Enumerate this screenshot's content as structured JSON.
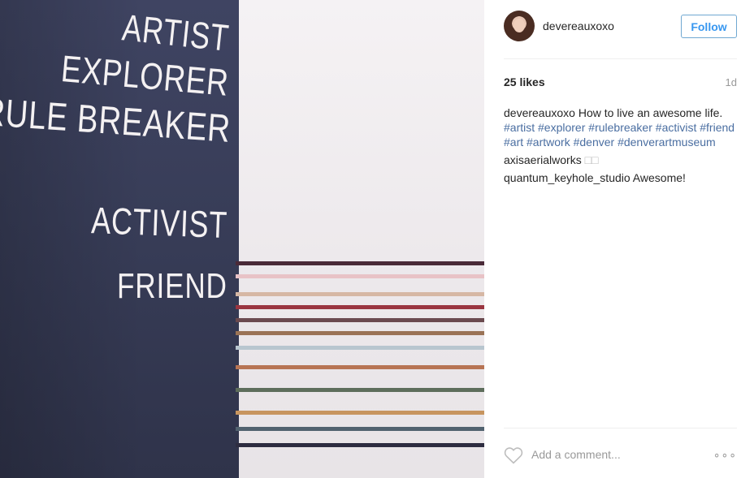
{
  "photo": {
    "words": [
      "ARTIST",
      "EXPLORER",
      "RULE BREAKER",
      "ACTIVIST",
      "FRIEND"
    ],
    "stripe_colors": [
      "#4a2a38",
      "#e8c2c6",
      "#d6b7a4",
      "#9a3540",
      "#6b4a4f",
      "#9a7356",
      "#b8c6cf",
      "#b77454",
      "#5e6e5c",
      "#c7955f",
      "#51626f",
      "#2d2c40"
    ]
  },
  "header": {
    "username": "devereauxoxo",
    "follow_label": "Follow"
  },
  "stats": {
    "likes": "25 likes",
    "time": "1d"
  },
  "caption": {
    "user": "devereauxoxo",
    "text": "How to live an awesome life.",
    "hashtags": [
      "#artist",
      "#explorer",
      "#rulebreaker",
      "#activist",
      "#friend",
      "#art",
      "#artwork",
      "#denver",
      "#denverartmuseum"
    ]
  },
  "comments": [
    {
      "user": "axisaerialworks",
      "text": "□□"
    },
    {
      "user": "quantum_keyhole_studio",
      "text": "Awesome!"
    }
  ],
  "add_comment": {
    "placeholder": "Add a comment...",
    "more_label": "∘∘∘"
  },
  "colors": {
    "follow_blue": "#3897f0",
    "hashtag": "#4a6ea1",
    "wall": "#3a3f5c"
  }
}
